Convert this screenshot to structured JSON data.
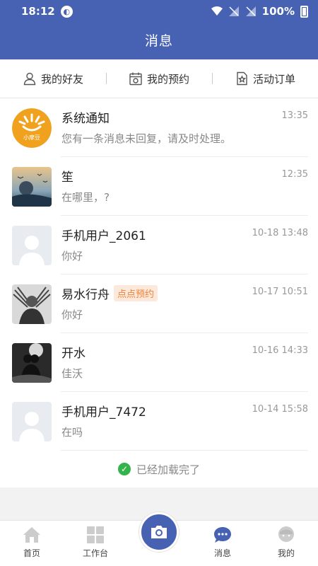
{
  "status_bar": {
    "time": "18:12",
    "battery": "100%"
  },
  "header": {
    "title": "消息"
  },
  "tabs": [
    {
      "label": "我的好友",
      "icon": "person-icon"
    },
    {
      "label": "我的预约",
      "icon": "calendar-icon"
    },
    {
      "label": "活动订单",
      "icon": "star-doc-icon"
    }
  ],
  "messages": [
    {
      "name": "系统通知",
      "time": "13:35",
      "text": "您有一条消息未回复，请及时处理。",
      "avatar": "logo",
      "logo_text": "小摩豆"
    },
    {
      "name": "笙",
      "time": "12:35",
      "text": "在哪里，?",
      "avatar": "landscape"
    },
    {
      "name": "手机用户_2061",
      "time": "10-18 13:48",
      "text": "你好",
      "avatar": "default"
    },
    {
      "name": "易水行舟",
      "time": "10-17 10:51",
      "text": "你好",
      "tag": "点点预约",
      "avatar": "wolverine"
    },
    {
      "name": "开水",
      "time": "10-16 14:33",
      "text": "佳沃",
      "avatar": "couple"
    },
    {
      "name": "手机用户_7472",
      "time": "10-14 15:58",
      "text": "在吗",
      "avatar": "default"
    }
  ],
  "loaded_text": "已经加载完了",
  "bottom_nav": {
    "home": "首页",
    "workbench": "工作台",
    "messages": "消息",
    "mine": "我的"
  },
  "colors": {
    "brand": "#4862b3",
    "tag_bg": "#fde9db",
    "tag_text": "#f08235",
    "success": "#34b34a"
  }
}
